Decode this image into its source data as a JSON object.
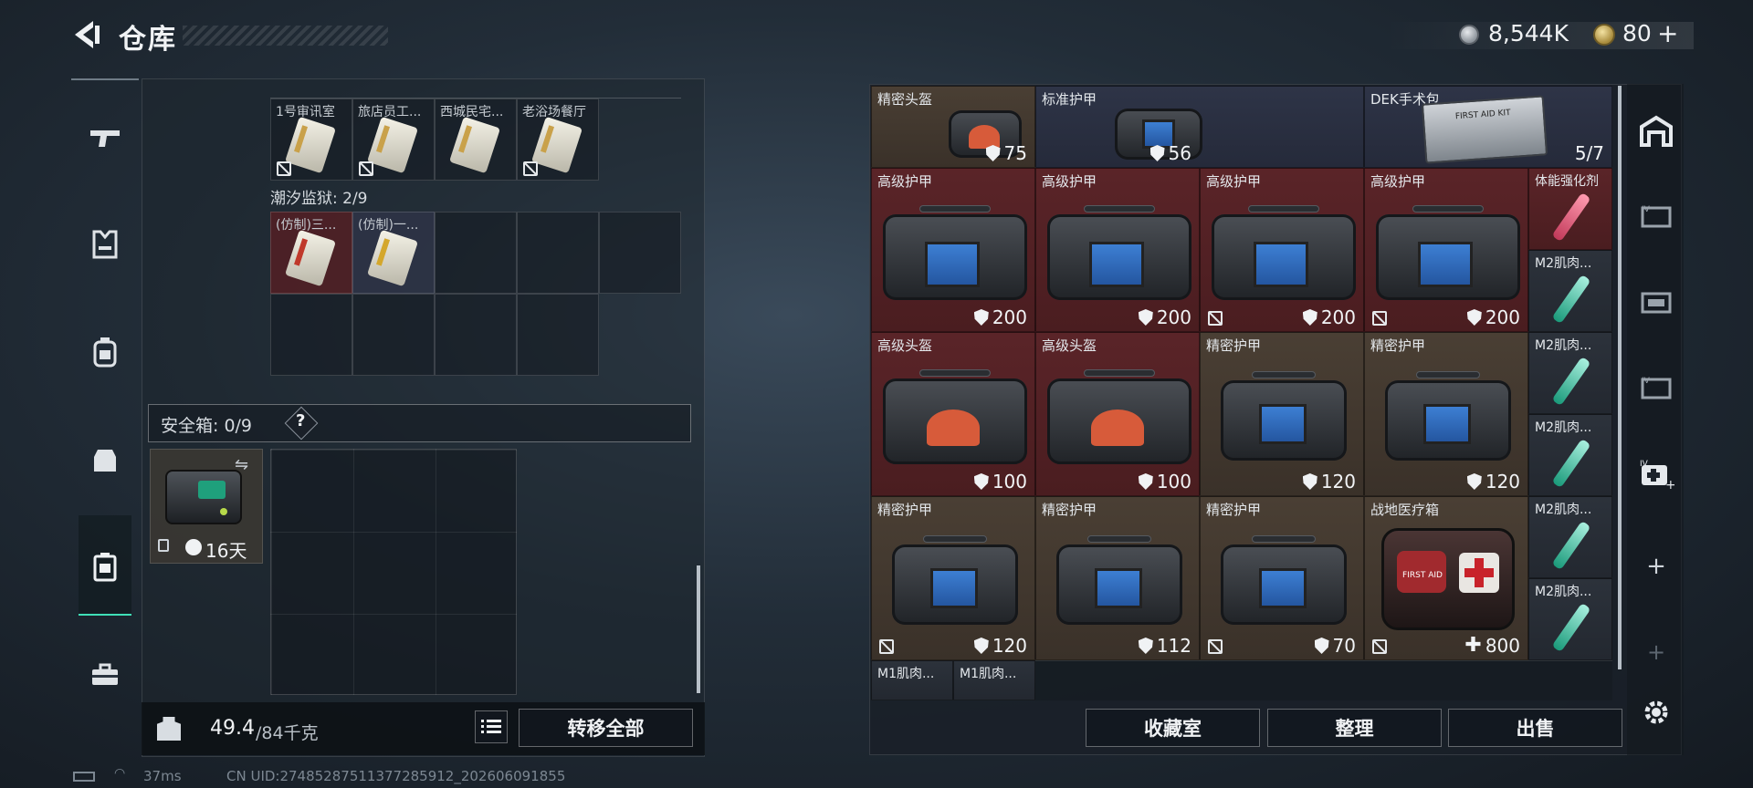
{
  "header": {
    "title": "仓库",
    "currency_silver": "8,544K",
    "currency_gold": "80",
    "gold_plus": "+"
  },
  "left_panel": {
    "top_row_cards": [
      "1号审讯室",
      "旅店员工...",
      "西城民宅...",
      "老浴场餐厅"
    ],
    "prison_label": "潮汐监狱: 2/9",
    "prison_cards": [
      "(仿制)三...",
      "(仿制)一..."
    ],
    "safebox_label": "安全箱: 0/9",
    "safebox_help": "?",
    "safebox_timer": "16天",
    "weight_current": "49.4",
    "weight_max": "/84千克",
    "transfer_all": "转移全部"
  },
  "warehouse": {
    "row1": [
      {
        "name": "精密头盔",
        "value": "75"
      },
      {
        "name": "标准护甲",
        "value": "56"
      },
      {
        "name": "DEK手术包",
        "value": "5/7"
      }
    ],
    "row2": [
      {
        "name": "高级护甲",
        "value": "200"
      },
      {
        "name": "高级护甲",
        "value": "200"
      },
      {
        "name": "高级护甲",
        "value": "200"
      },
      {
        "name": "高级护甲",
        "value": "200"
      },
      {
        "name": "体能强化剂"
      }
    ],
    "row3": [
      {
        "name": "高级头盔",
        "value": "100"
      },
      {
        "name": "高级头盔",
        "value": "100"
      },
      {
        "name": "精密护甲",
        "value": "120"
      },
      {
        "name": "精密护甲",
        "value": "120"
      }
    ],
    "row4": [
      {
        "name": "精密护甲",
        "value": "120"
      },
      {
        "name": "精密护甲",
        "value": "112"
      },
      {
        "name": "精密护甲",
        "value": "70"
      },
      {
        "name": "战地医疗箱",
        "value": "800"
      }
    ],
    "side_small": [
      "M2肌肉...",
      "M2肌肉...",
      "M2肌肉...",
      "M2肌肉...",
      "M2肌肉..."
    ],
    "row5": [
      "M1肌肉...",
      "M1肌肉..."
    ],
    "kit_label": "FIRST AID KIT",
    "medbox_label": "FIRST AID"
  },
  "bottom_buttons": {
    "collection": "收藏室",
    "organize": "整理",
    "sell": "出售"
  },
  "status": {
    "ping": "37ms",
    "uid": "CN UID:27485287511377285912_202606091855"
  }
}
